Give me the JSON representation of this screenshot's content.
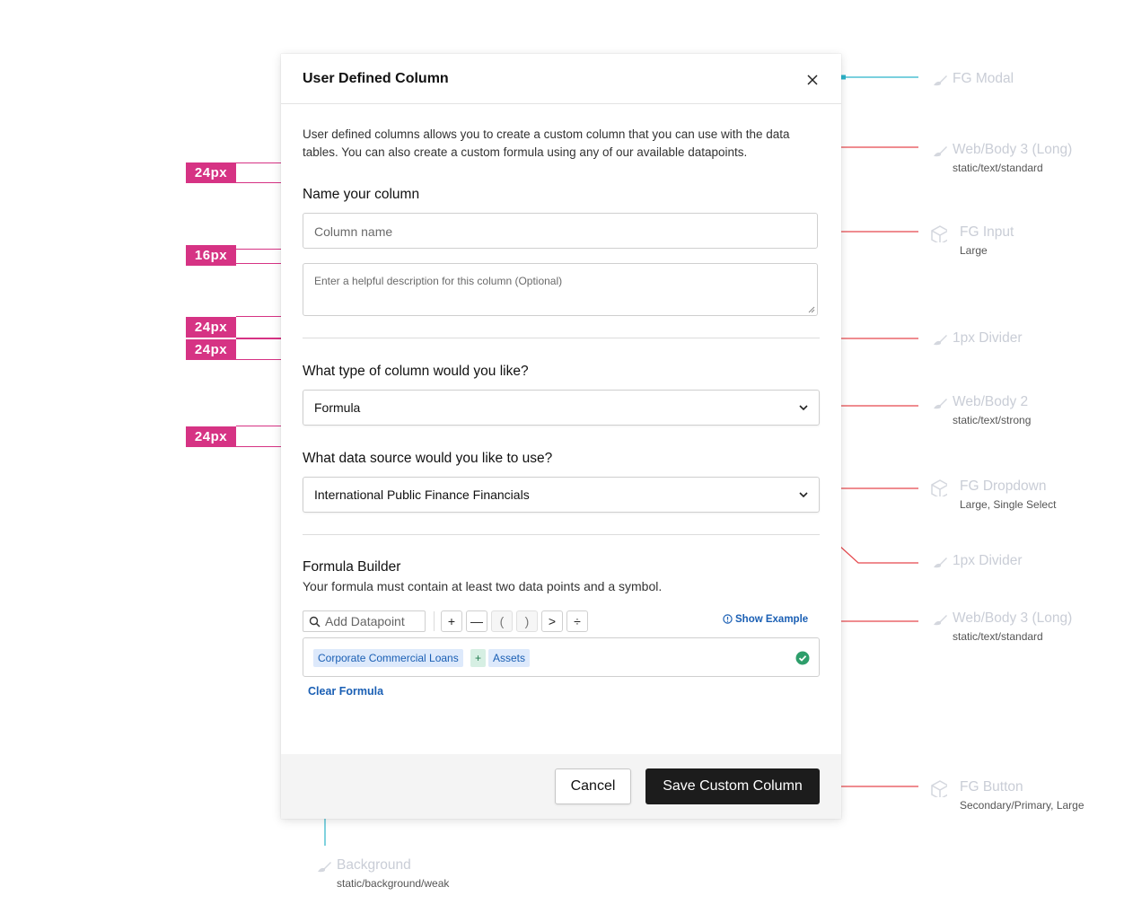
{
  "modal": {
    "title": "User Defined Column",
    "intro": "User defined columns allows you to create a custom column that you can use with the data tables. You can also create a custom formula using any of our available datapoints.",
    "name_label": "Name your column",
    "name_placeholder": "Column name",
    "desc_placeholder": "Enter a helpful description for this column (Optional)",
    "type_label": "What type of column would you like?",
    "type_value": "Formula",
    "source_label": "What data source would you like to use?",
    "source_value": "International Public Finance Financials",
    "formula": {
      "title": "Formula Builder",
      "subtitle": "Your formula must contain at least two data points and a symbol.",
      "search_placeholder": "Add Datapoint",
      "operators": [
        "+",
        "—",
        "(",
        ")",
        ">",
        "÷"
      ],
      "show_example": "Show Example",
      "chips": [
        "Corporate Commercial Loans",
        "+",
        "Assets"
      ],
      "status": "valid",
      "clear_label": "Clear Formula"
    },
    "buttons": {
      "cancel": "Cancel",
      "save": "Save Custom Column"
    }
  },
  "measurements": [
    "24px",
    "16px",
    "24px",
    "24px",
    "24px"
  ],
  "annotations": [
    {
      "title": "FG Modal",
      "sub": "",
      "icon": "brush-icon"
    },
    {
      "title": "Web/Body 3 (Long)",
      "sub": "static/text/standard",
      "icon": "brush-icon"
    },
    {
      "title": "FG Input",
      "sub": "Large",
      "icon": "component-icon"
    },
    {
      "title": "1px Divider",
      "sub": "",
      "icon": "brush-icon"
    },
    {
      "title": "Web/Body 2",
      "sub": "static/text/strong",
      "icon": "brush-icon"
    },
    {
      "title": "FG Dropdown",
      "sub": "Large, Single Select",
      "icon": "component-icon"
    },
    {
      "title": "1px Divider",
      "sub": "",
      "icon": "brush-icon"
    },
    {
      "title": "Web/Body 3 (Long)",
      "sub": "static/text/standard",
      "icon": "brush-icon"
    },
    {
      "title": "FG Button",
      "sub": "Secondary/Primary, Large",
      "icon": "component-icon"
    },
    {
      "title": "Background",
      "sub": "static/background/weak",
      "icon": "brush-icon"
    }
  ],
  "colors": {
    "measure": "#d63384",
    "callout_red": "#e5484d",
    "callout_teal": "#2bb3c9",
    "primary_button": "#1c1c1c",
    "link": "#1a5fb4",
    "footer_bg": "#f4f4f4"
  }
}
